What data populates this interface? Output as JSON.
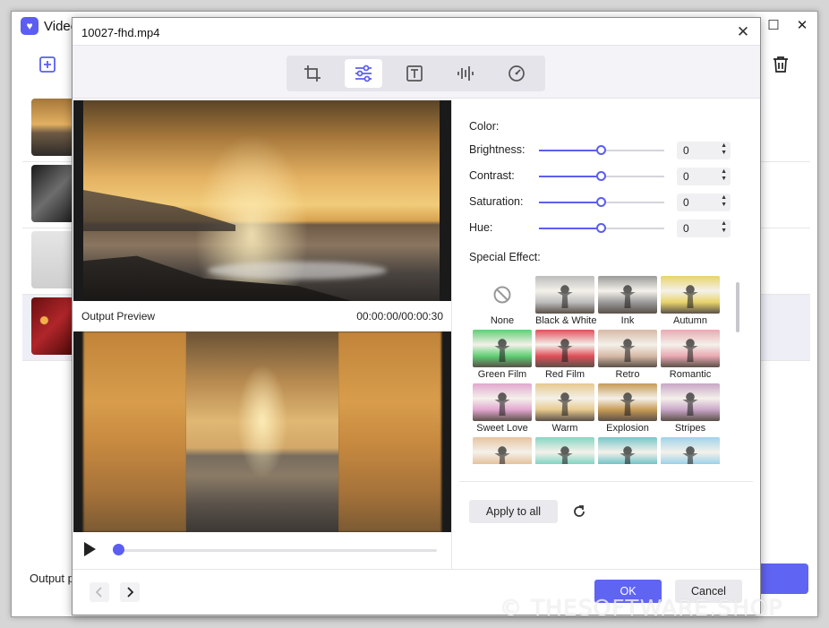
{
  "app": {
    "title": "Video",
    "output_label": "Output p"
  },
  "dialog": {
    "title": "10027-fhd.mp4",
    "tabs": [
      {
        "name": "crop-tab",
        "icon": "crop-icon",
        "active": false
      },
      {
        "name": "adjust-tab",
        "icon": "sliders-icon",
        "active": true
      },
      {
        "name": "text-tab",
        "icon": "text-icon",
        "active": false
      },
      {
        "name": "audio-tab",
        "icon": "audio-wave-icon",
        "active": false
      },
      {
        "name": "speed-tab",
        "icon": "speedometer-icon",
        "active": false
      }
    ],
    "preview": {
      "output_label": "Output Preview",
      "time": "00:00:00/00:00:30",
      "progress": 0
    },
    "color": {
      "label": "Color:",
      "adjustments": [
        {
          "label": "Brightness:",
          "value": "0",
          "level": 0.5
        },
        {
          "label": "Contrast:",
          "value": "0",
          "level": 0.5
        },
        {
          "label": "Saturation:",
          "value": "0",
          "level": 0.5
        },
        {
          "label": "Hue:",
          "value": "0",
          "level": 0.5
        }
      ]
    },
    "special_effect": {
      "label": "Special Effect:",
      "effects": [
        {
          "name": "None",
          "tint": "none"
        },
        {
          "name": "Black & White",
          "tint": "#bdbdbd"
        },
        {
          "name": "Ink",
          "tint": "#9a9a9a"
        },
        {
          "name": "Autumn",
          "tint": "#e8d46a"
        },
        {
          "name": "Green Film",
          "tint": "#5fcf74"
        },
        {
          "name": "Red Film",
          "tint": "#e0505a"
        },
        {
          "name": "Retro",
          "tint": "#d7b9a6"
        },
        {
          "name": "Romantic",
          "tint": "#e9a9b2"
        },
        {
          "name": "Sweet Love",
          "tint": "#e2a6cf"
        },
        {
          "name": "Warm",
          "tint": "#e6c98e"
        },
        {
          "name": "Explosion",
          "tint": "#c79a55"
        },
        {
          "name": "Stripes",
          "tint": "#c9a6c7"
        },
        {
          "name": "",
          "tint": "#e6c4a0"
        },
        {
          "name": "",
          "tint": "#86d6c4"
        },
        {
          "name": "",
          "tint": "#78c6c9"
        },
        {
          "name": "",
          "tint": "#9fd3ea"
        }
      ]
    },
    "apply_all_label": "Apply to all",
    "ok_label": "OK",
    "cancel_label": "Cancel"
  },
  "watermark": "© THESOFTWARE.SHOP",
  "colors": {
    "accent": "#5b5ef0",
    "button_bg": "#eaeaee"
  }
}
